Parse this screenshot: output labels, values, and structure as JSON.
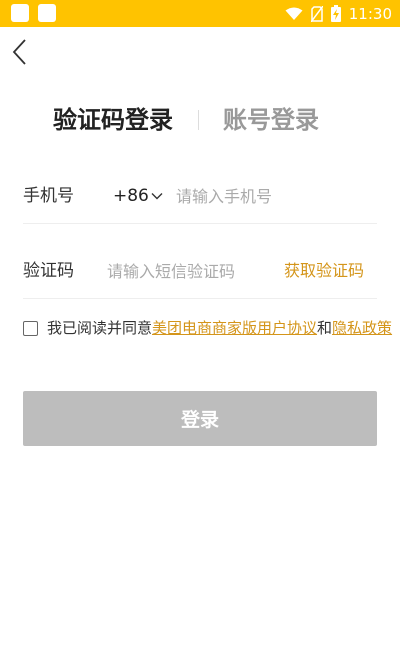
{
  "status_bar": {
    "time": "11:30",
    "background": "#ffc300",
    "icons": [
      "app-notification-icon",
      "app-notification-icon",
      "wifi-icon",
      "no-sim-icon",
      "battery-charging-icon"
    ]
  },
  "header": {
    "back_icon": "chevron-left-icon"
  },
  "tabs": [
    {
      "label": "验证码登录",
      "active": true
    },
    {
      "label": "账号登录",
      "active": false
    }
  ],
  "phone_row": {
    "label": "手机号",
    "country_code": "+86",
    "placeholder": "请输入手机号"
  },
  "code_row": {
    "label": "验证码",
    "placeholder": "请输入短信验证码",
    "get_code_label": "获取验证码"
  },
  "agreement": {
    "checked": false,
    "prefix": "我已阅读并同意",
    "link1": "美团电商商家版用户协议",
    "conjunction": "和",
    "link2": "隐私政策"
  },
  "login_button": {
    "label": "登录",
    "enabled": false
  },
  "colors": {
    "accent": "#ffc300",
    "link": "#d4951a",
    "disabled_button": "#bdbdbd"
  }
}
